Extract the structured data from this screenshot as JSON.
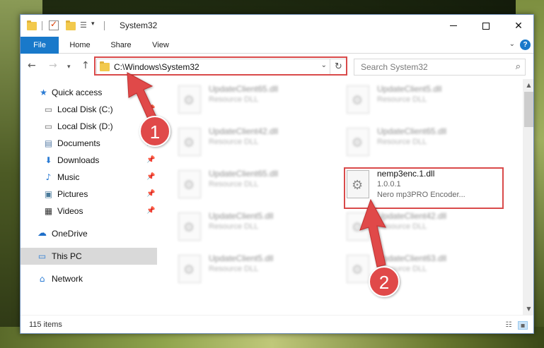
{
  "window": {
    "title": "System32",
    "title_icons": [
      "folder-icon",
      "properties-check-icon",
      "new-folder-icon",
      "customize-toolbar-icon"
    ]
  },
  "ribbon": {
    "tabs": [
      {
        "label": "File",
        "active": true
      },
      {
        "label": "Home"
      },
      {
        "label": "Share"
      },
      {
        "label": "View"
      }
    ]
  },
  "navigation": {
    "address": "C:\\Windows\\System32",
    "search_placeholder": "Search System32"
  },
  "sidebar": {
    "items": [
      {
        "label": "Quick access",
        "icon": "star-icon"
      },
      {
        "label": "Local Disk (C:)",
        "icon": "drive-c-icon",
        "pinned": true
      },
      {
        "label": "Local Disk (D:)",
        "icon": "drive-d-icon"
      },
      {
        "label": "Documents",
        "icon": "documents-icon",
        "pinned": true
      },
      {
        "label": "Downloads",
        "icon": "downloads-icon",
        "pinned": true
      },
      {
        "label": "Music",
        "icon": "music-icon",
        "pinned": true
      },
      {
        "label": "Pictures",
        "icon": "pictures-icon",
        "pinned": true
      },
      {
        "label": "Videos",
        "icon": "videos-icon",
        "pinned": true
      },
      {
        "label": "OneDrive",
        "icon": "onedrive-icon"
      },
      {
        "label": "This PC",
        "icon": "this-pc-icon",
        "selected": true
      },
      {
        "label": "Network",
        "icon": "network-icon"
      }
    ]
  },
  "files": {
    "left": [
      {
        "name": "UpdateClient65.dll",
        "type": "Resource DLL"
      },
      {
        "name": "UpdateClient42.dll",
        "type": "Resource DLL"
      },
      {
        "name": "UpdateClient65.dll",
        "type": "Resource DLL"
      },
      {
        "name": "UpdateClient5.dll",
        "type": "Resource DLL"
      },
      {
        "name": "UpdateClient5.dll",
        "type": "Resource DLL"
      }
    ],
    "right": [
      {
        "name": "UpdateClient5.dll",
        "type": "Resource DLL"
      },
      {
        "name": "UpdateClient65.dll",
        "type": "Resource DLL"
      },
      {
        "name": "UpdateClient42.dll",
        "type": "Resource DLL"
      },
      {
        "name": "UpdateClient63.dll",
        "type": "Resource DLL"
      }
    ],
    "highlighted": {
      "name": "nemp3enc.1.dll",
      "version": "1.0.0.1",
      "description": "Nero mp3PRO Encoder..."
    }
  },
  "status": {
    "item_count": "115 items"
  },
  "annotations": {
    "step1": "1",
    "step2": "2",
    "color": "#d94a4a"
  }
}
